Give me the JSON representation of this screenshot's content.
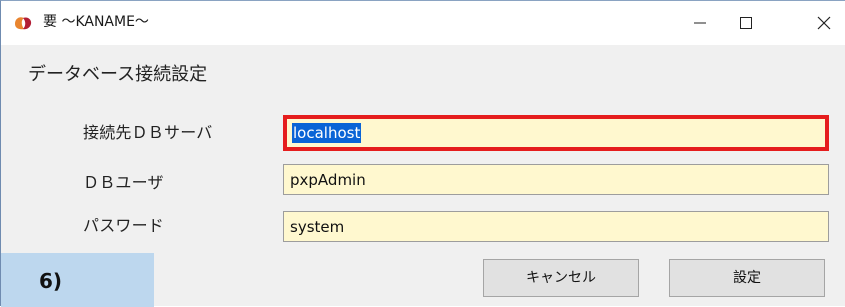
{
  "window": {
    "title": "要 ～KANAME～",
    "controls": {
      "minimize_icon": "minimize-icon",
      "maximize_icon": "maximize-icon",
      "close_icon": "close-icon"
    }
  },
  "dialog": {
    "heading": "データベース接続設定",
    "fields": {
      "server": {
        "label": "接続先ＤＢサーバ",
        "value": "localhost"
      },
      "user": {
        "label": "ＤＢユーザ",
        "value": "pxpAdmin"
      },
      "password": {
        "label": "パスワード",
        "value": "system"
      }
    },
    "buttons": {
      "cancel": "キャンセル",
      "set": "設定"
    }
  },
  "annotation": {
    "step": "6)"
  },
  "colors": {
    "highlight_border": "#e51d1d",
    "input_background": "#fff8cf",
    "selection": "#0a64d6",
    "step_badge": "#bdd7ee"
  }
}
